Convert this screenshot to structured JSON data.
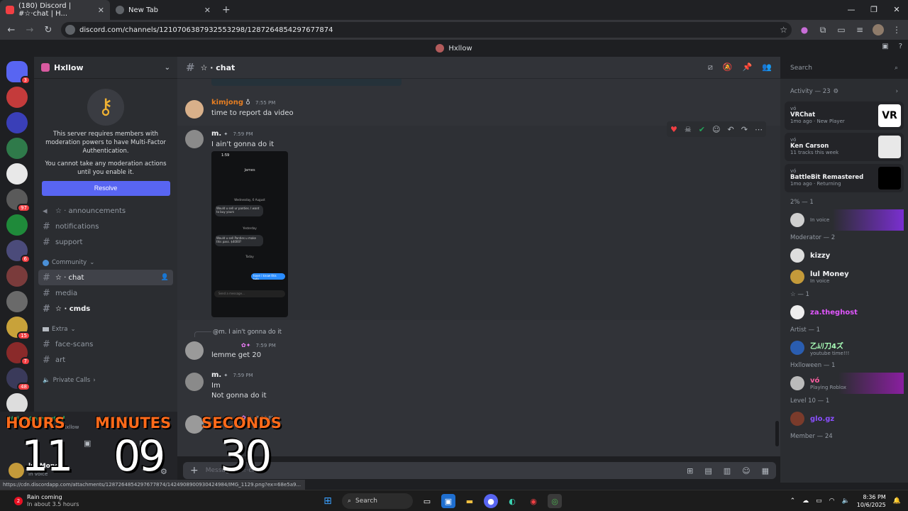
{
  "browser": {
    "tabs": [
      {
        "label": "(180) Discord | #☆·chat | H...",
        "active": true
      },
      {
        "label": "New Tab",
        "active": false
      }
    ],
    "url": "discord.com/channels/1210706387932553298/1287264854297677874",
    "status_url": "https://cdn.discordapp.com/attachments/1287264854297677874/1424908900930424984/IMG_1129.png?ex=68e5a9..."
  },
  "discord": {
    "window_title": "Hxllow",
    "rail_badges": [
      "3",
      "97",
      "6",
      "15",
      "7",
      "48"
    ],
    "server": {
      "name": "Hxllow",
      "mfa_text": "This server requires members with moderation powers to have Multi-Factor Authentication.",
      "mfa_text2": "You cannot take any moderation actions until you enable it.",
      "resolve_label": "Resolve"
    },
    "channels": [
      {
        "name": "☆ · announcements",
        "type": "announce"
      },
      {
        "name": "notifications",
        "type": "text"
      },
      {
        "name": "support",
        "type": "text"
      }
    ],
    "categories": {
      "community": "Community",
      "extra": "Extra",
      "private_calls": "Private Calls"
    },
    "community_channels": [
      {
        "name": "☆ · chat",
        "active": true
      },
      {
        "name": "media",
        "active": false
      },
      {
        "name": "☆ · cmds",
        "bold": true
      }
    ],
    "extra_channels": [
      {
        "name": "face-scans"
      },
      {
        "name": "art"
      }
    ],
    "user_panel": {
      "connected": "Voice Connected",
      "server_label": "Hxllow",
      "username": "lul Money",
      "status": "In voice"
    },
    "chat": {
      "channel_title": "☆ · chat",
      "search_placeholder": "Search",
      "composer_placeholder": "Message #☆·chat",
      "messages": [
        {
          "user": "kimjong",
          "time": "7:55 PM",
          "text": "time to report da video"
        },
        {
          "user": "m.",
          "time": "7:59 PM",
          "text": "I ain't gonna do it"
        },
        {
          "reply": "@m. I ain't gonna do it",
          "time": "7:59 PM",
          "text": "lemme get 20"
        },
        {
          "user": "m.",
          "time": "7:59 PM",
          "text1": "Im",
          "text2": "Not gonna do it"
        },
        {
          "time": "7:59 PM"
        }
      ],
      "screenshot": {
        "time": "1:59",
        "title": "James",
        "day1": "Wednesday, 6 August",
        "bubble1": "Would u sell ur panties. I want to buy yours",
        "day2": "Yesterday",
        "bubble2": "Would u sell Panties u make this pass. $4000?",
        "day3": "Today",
        "sent": "have i know this tells",
        "input": "Send a message..."
      }
    },
    "members": {
      "activity_header": "Activity — 23",
      "activities": [
        {
          "user": "vó",
          "game": "VRChat",
          "sub": "1mo ago · New Player"
        },
        {
          "user": "vó",
          "game": "Ken Carson",
          "sub": "11 tracks this week"
        },
        {
          "user": "vó",
          "game": "BattleBit Remastered",
          "sub": "1mo ago · Returning"
        }
      ],
      "groups": [
        {
          "header": "2% — 1",
          "members": [
            {
              "name": "",
              "status": "In voice",
              "color": "#f2f3f5"
            }
          ]
        },
        {
          "header": "Moderator — 2",
          "members": [
            {
              "name": "kizzy",
              "status": "",
              "color": "#f2f3f5"
            },
            {
              "name": "lul Money",
              "status": "In voice",
              "color": "#f2f3f5"
            }
          ]
        },
        {
          "header": "☆ — 1",
          "members": [
            {
              "name": "za.theghost",
              "status": "",
              "color": "#e056fd"
            }
          ]
        },
        {
          "header": "Artist — 1",
          "members": [
            {
              "name": "乙ﾑﾘ刀4ズ",
              "status": "youtube time!!!",
              "color": "#a9ffb8"
            }
          ]
        },
        {
          "header": "Hxlloween — 1",
          "members": [
            {
              "name": "vó",
              "status": "Playing Roblox",
              "color": "#ff5fa2"
            }
          ]
        },
        {
          "header": "Level 10 — 1",
          "members": [
            {
              "name": "glo.gz",
              "status": "",
              "color": "#8a4fff"
            }
          ]
        },
        {
          "header": "Member — 24",
          "members": []
        }
      ]
    }
  },
  "overlay": {
    "hours_label": "HOURS",
    "minutes_label": "MINUTES",
    "seconds_label": "SECONDS",
    "hours": "11",
    "minutes": "09",
    "seconds": "30"
  },
  "taskbar": {
    "weather_title": "Rain coming",
    "weather_sub": "In about 3.5 hours",
    "weather_badge": "2",
    "search_label": "Search",
    "time": "8:36 PM",
    "date": "10/6/2025"
  }
}
